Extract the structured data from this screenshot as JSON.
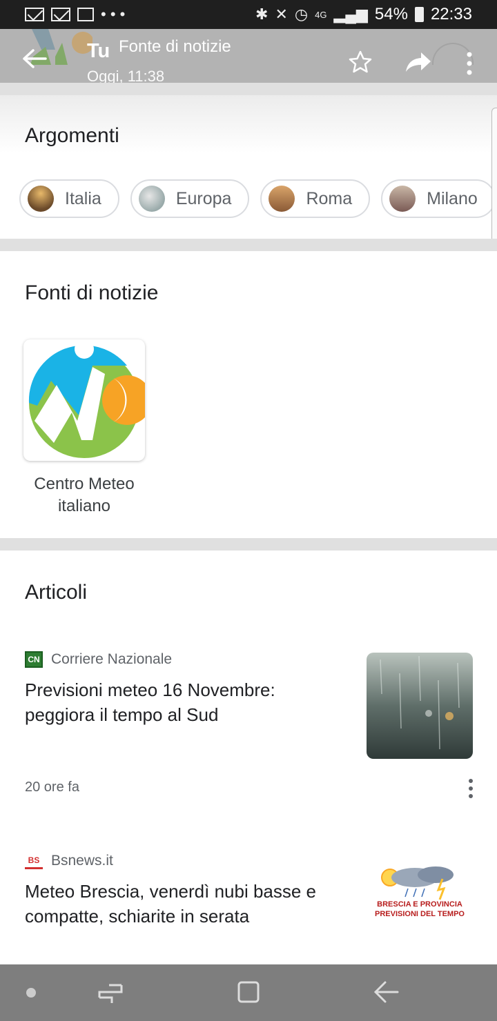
{
  "status_bar": {
    "more": "• • •",
    "network": "4G",
    "battery": "54%",
    "time": "22:33"
  },
  "header": {
    "title": "Tu",
    "subtitle": "Fonte di notizie",
    "timestamp": "Oggi, 11:38"
  },
  "topics": {
    "title": "Argomenti",
    "chips": [
      {
        "label": "Italia"
      },
      {
        "label": "Europa"
      },
      {
        "label": "Roma"
      },
      {
        "label": "Milano"
      }
    ]
  },
  "sources": {
    "title": "Fonti di notizie",
    "items": [
      {
        "name": "Centro Meteo italiano"
      }
    ]
  },
  "articles": {
    "title": "Articoli",
    "items": [
      {
        "publisher": "Corriere Nazionale",
        "publisher_icon": "CN",
        "title": "Previsioni meteo 16 Novembre: peggiora il tempo al Sud",
        "time": "20 ore fa"
      },
      {
        "publisher": "Bsnews.it",
        "publisher_icon": "BS",
        "title": "Meteo Brescia, venerdì nubi basse e compatte, schiarite in serata",
        "thumb_line1": "BRESCIA E PROVINCIA",
        "thumb_line2": "PREVISIONI DEL TEMPO"
      }
    ]
  }
}
